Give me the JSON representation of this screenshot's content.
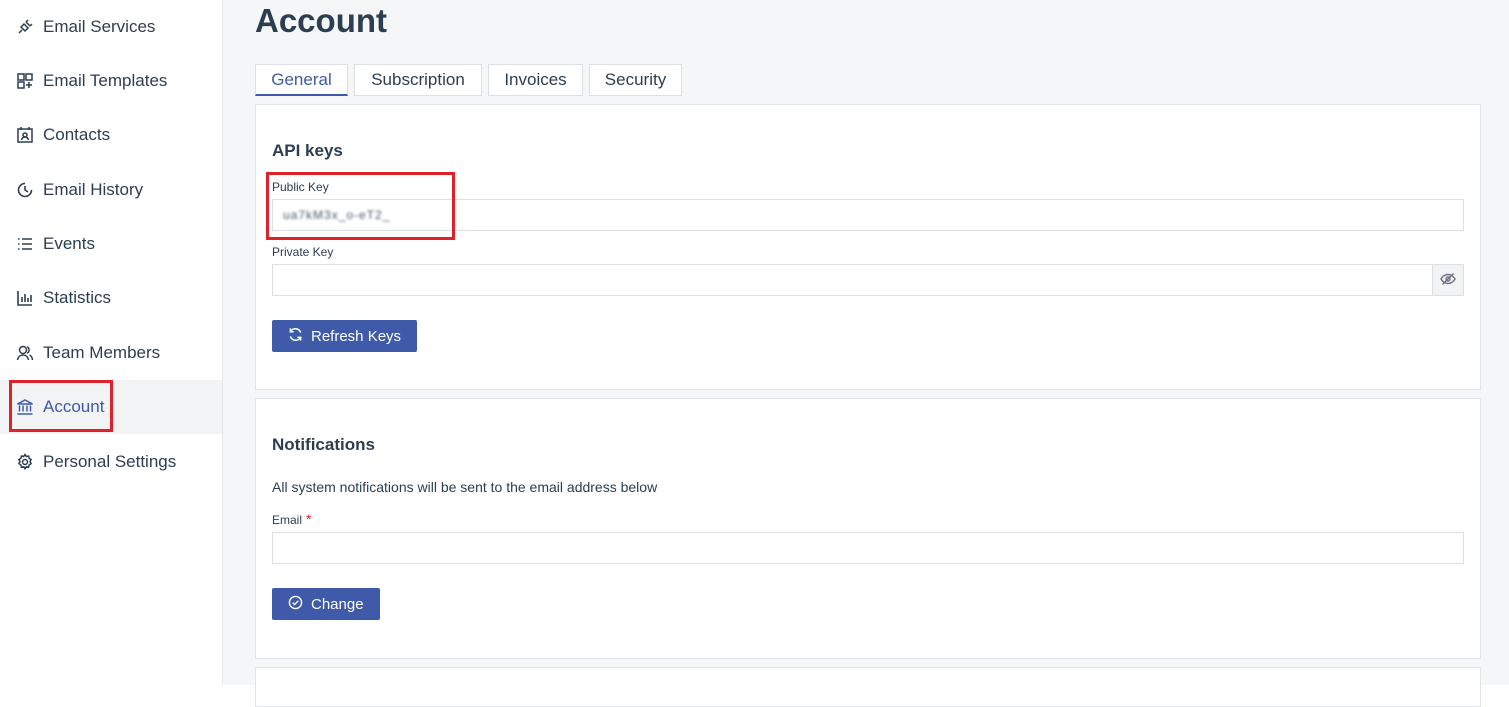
{
  "sidebar": {
    "items": [
      {
        "label": "Email Services",
        "icon": "plug-icon"
      },
      {
        "label": "Email Templates",
        "icon": "templates-icon"
      },
      {
        "label": "Contacts",
        "icon": "contact-card-icon"
      },
      {
        "label": "Email History",
        "icon": "clock-icon"
      },
      {
        "label": "Events",
        "icon": "list-icon"
      },
      {
        "label": "Statistics",
        "icon": "bar-chart-icon"
      },
      {
        "label": "Team Members",
        "icon": "users-icon"
      },
      {
        "label": "Account",
        "icon": "bank-icon",
        "active": true
      },
      {
        "label": "Personal Settings",
        "icon": "gear-icon"
      }
    ]
  },
  "page": {
    "title": "Account"
  },
  "tabs": [
    {
      "label": "General",
      "active": true
    },
    {
      "label": "Subscription"
    },
    {
      "label": "Invoices"
    },
    {
      "label": "Security"
    }
  ],
  "api_keys": {
    "heading": "API keys",
    "public_key_label": "Public Key",
    "public_key_value": "ua7kM3x_o-eT2_",
    "private_key_label": "Private Key",
    "private_key_value": "",
    "refresh_button": "Refresh Keys"
  },
  "notifications": {
    "heading": "Notifications",
    "description": "All system notifications will be sent to the email address below",
    "email_label": "Email",
    "required_mark": "*",
    "email_value": "",
    "change_button": "Change"
  },
  "colors": {
    "accent": "#3f5aa8",
    "highlight": "#e0202b",
    "active_bg": "#f2f3f5"
  }
}
